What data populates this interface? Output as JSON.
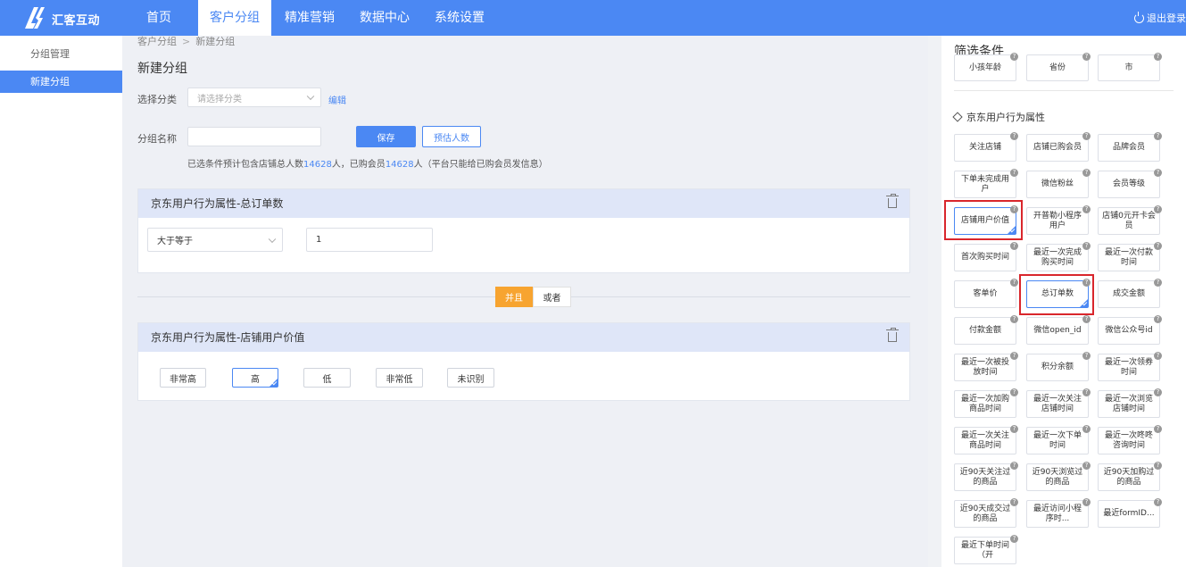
{
  "app": {
    "brand": "汇客互动",
    "logout": "退出登录"
  },
  "nav": [
    "首页",
    "客户分组",
    "精准营销",
    "数据中心",
    "系统设置"
  ],
  "sidebar": [
    "分组管理",
    "新建分组"
  ],
  "breadcrumb": [
    "客户分组",
    "新建分组"
  ],
  "page_title": "新建分组",
  "form": {
    "category_label": "选择分类",
    "category_placeholder": "请选择分类",
    "edit_link": "编辑",
    "name_label": "分组名称",
    "save": "保存",
    "estimate": "预估人数",
    "hint_prefix": "已选条件预计包含店铺总人数",
    "hint_total": "14628",
    "hint_mid": "人，已购会员",
    "hint_members": "14628",
    "hint_suffix": "人（平台只能给已购会员发信息）"
  },
  "panel1": {
    "title": "京东用户行为属性-总订单数",
    "operator": "大于等于",
    "value": "1"
  },
  "logic": {
    "and": "并且",
    "or": "或者"
  },
  "panel2": {
    "title": "京东用户行为属性-店铺用户价值",
    "options": [
      "非常高",
      "高",
      "低",
      "非常低",
      "未识别"
    ],
    "selected": "高"
  },
  "right": {
    "title": "筛选条件",
    "top_row": [
      "小孩年龄",
      "省份",
      "市"
    ],
    "section_title": "京东用户行为属性",
    "attrs": [
      "关注店铺",
      "店铺已购会员",
      "品牌会员",
      "下单未完成用户",
      "微信粉丝",
      "会员等级",
      "店铺用户价值",
      "开普勒小程序用户",
      "店铺0元开卡会员",
      "首次购买时间",
      "最近一次完成购买时间",
      "最近一次付款时间",
      "客单价",
      "总订单数",
      "成交金额",
      "付款金额",
      "微信open_id",
      "微信公众号id",
      "最近一次被投放时间",
      "积分余额",
      "最近一次领券时间",
      "最近一次加购商品时间",
      "最近一次关注店铺时间",
      "最近一次浏览店铺时间",
      "最近一次关注商品时间",
      "最近一次下单时间",
      "最近一次咚咚咨询时间",
      "近90天关注过的商品",
      "近90天浏览过的商品",
      "近90天加购过的商品",
      "近90天成交过的商品",
      "最近访问小程序时...",
      "最近formID...",
      "最近下单时间（开"
    ],
    "selected": [
      "店铺用户价值",
      "总订单数"
    ]
  }
}
